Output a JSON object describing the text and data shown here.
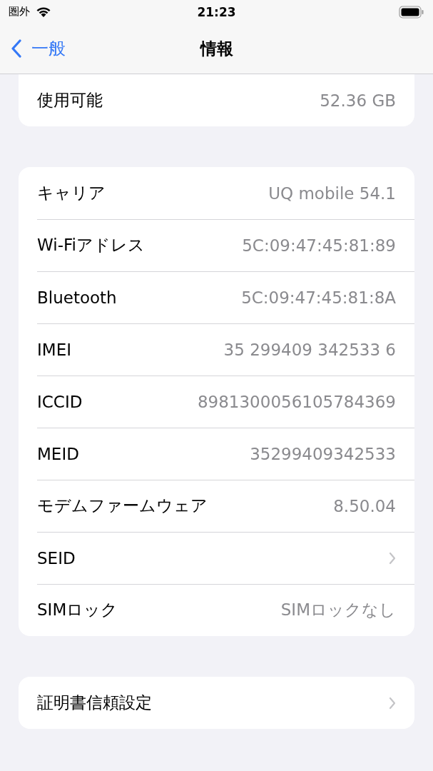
{
  "status_bar": {
    "carrier": "圏外",
    "time": "21:23"
  },
  "nav": {
    "back": "一般",
    "title": "情報"
  },
  "groups": [
    {
      "cut_top": true,
      "rows": [
        {
          "kind": "detail",
          "label": "使用可能",
          "value": "52.36 GB"
        }
      ]
    },
    {
      "cut_top": false,
      "rows": [
        {
          "kind": "detail",
          "label": "キャリア",
          "value": "UQ mobile 54.1"
        },
        {
          "kind": "detail",
          "label": "Wi-Fiアドレス",
          "value": "5C:09:47:45:81:89"
        },
        {
          "kind": "detail",
          "label": "Bluetooth",
          "value": "5C:09:47:45:81:8A"
        },
        {
          "kind": "detail",
          "label": "IMEI",
          "value": "35 299409 342533 6"
        },
        {
          "kind": "detail",
          "label": "ICCID",
          "value": "8981300056105784369"
        },
        {
          "kind": "detail",
          "label": "MEID",
          "value": "35299409342533"
        },
        {
          "kind": "detail",
          "label": "モデムファームウェア",
          "value": "8.50.04"
        },
        {
          "kind": "disclosure",
          "label": "SEID"
        },
        {
          "kind": "detail",
          "label": "SIMロック",
          "value": "SIMロックなし"
        }
      ]
    },
    {
      "cut_top": false,
      "rows": [
        {
          "kind": "disclosure",
          "label": "証明書信頼設定"
        }
      ]
    }
  ]
}
